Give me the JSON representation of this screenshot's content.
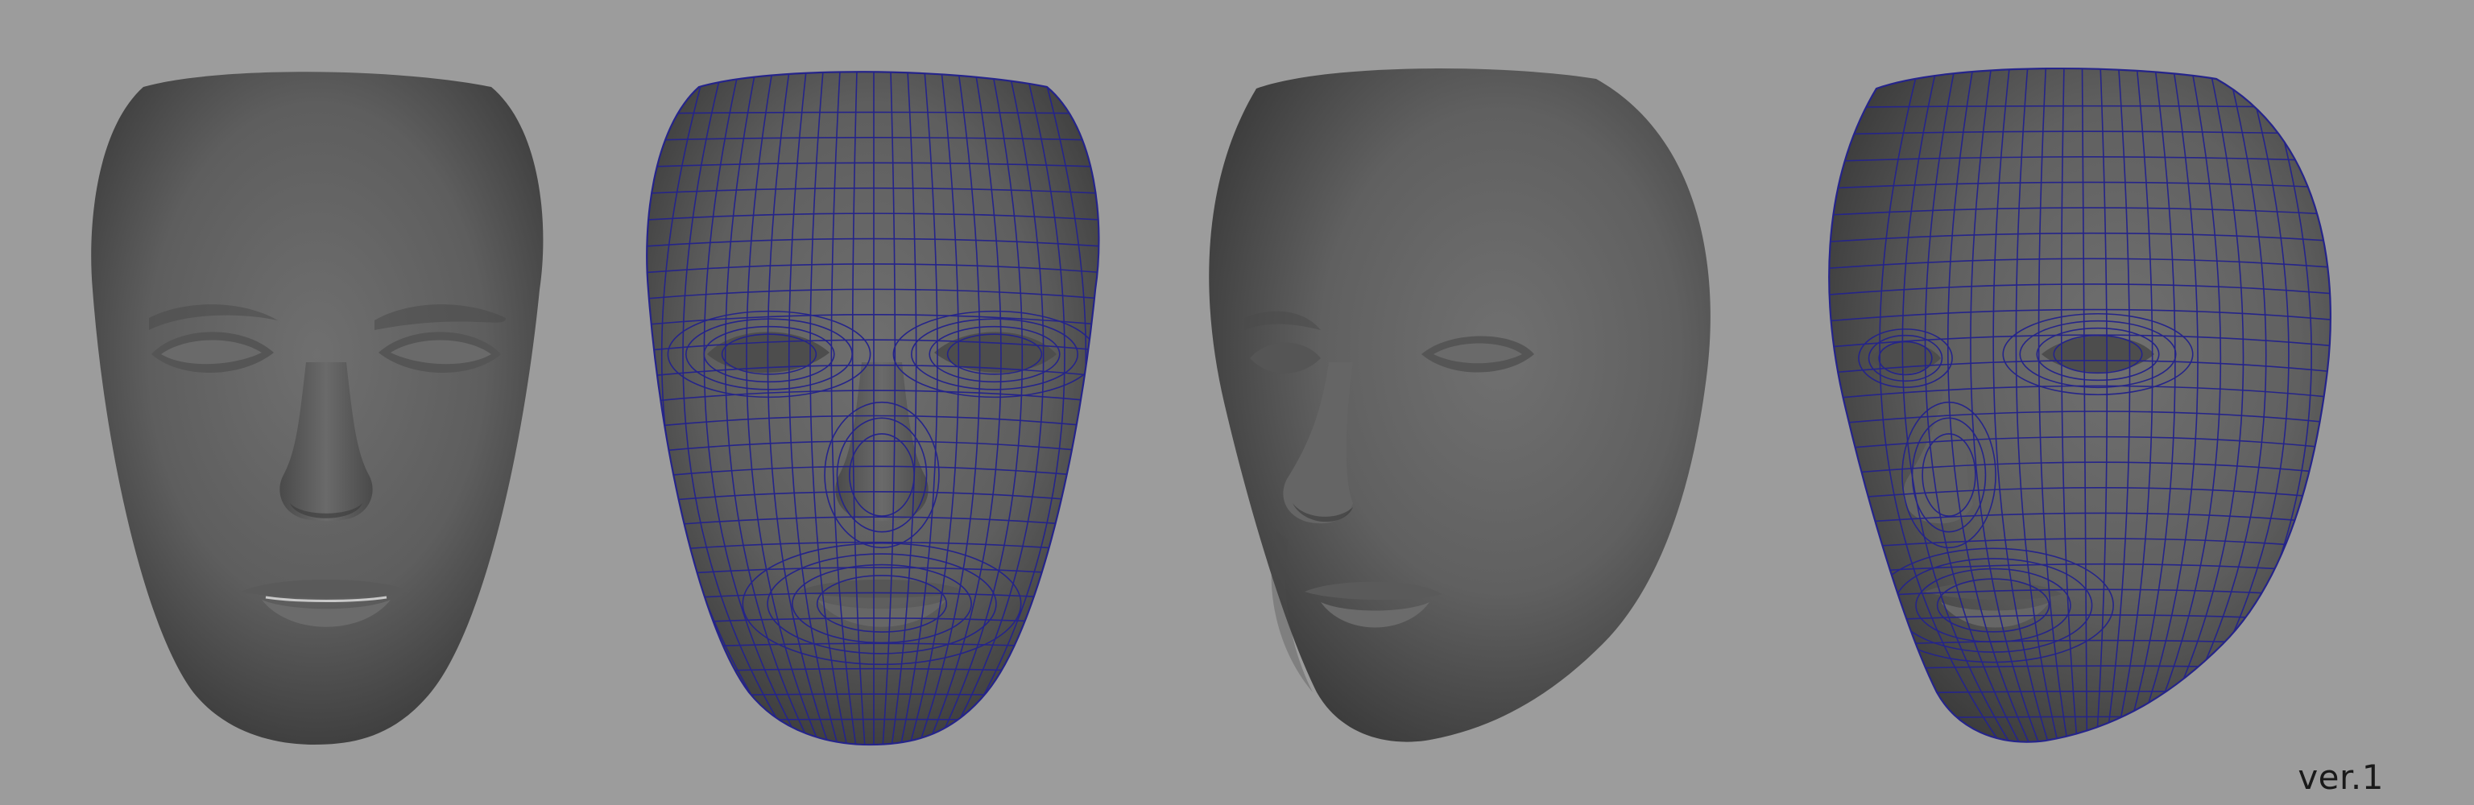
{
  "viewport": {
    "background_color": "#9c9c9c",
    "version_label": "ver.1",
    "label_color": "#1a1a1a"
  },
  "models": [
    {
      "name": "face-front-shaded",
      "view": "front",
      "display": "smooth-shaded"
    },
    {
      "name": "face-front-wireframe",
      "view": "front",
      "display": "wireframe-on-shaded"
    },
    {
      "name": "face-three-quarter-shaded",
      "view": "three-quarter",
      "display": "smooth-shaded"
    },
    {
      "name": "face-three-quarter-wireframe",
      "view": "three-quarter",
      "display": "wireframe-on-shaded"
    }
  ],
  "colors": {
    "skin_light": "#6e6e6e",
    "skin_mid": "#5d5d5d",
    "skin_dark": "#383838",
    "wireframe": "#25248a"
  }
}
